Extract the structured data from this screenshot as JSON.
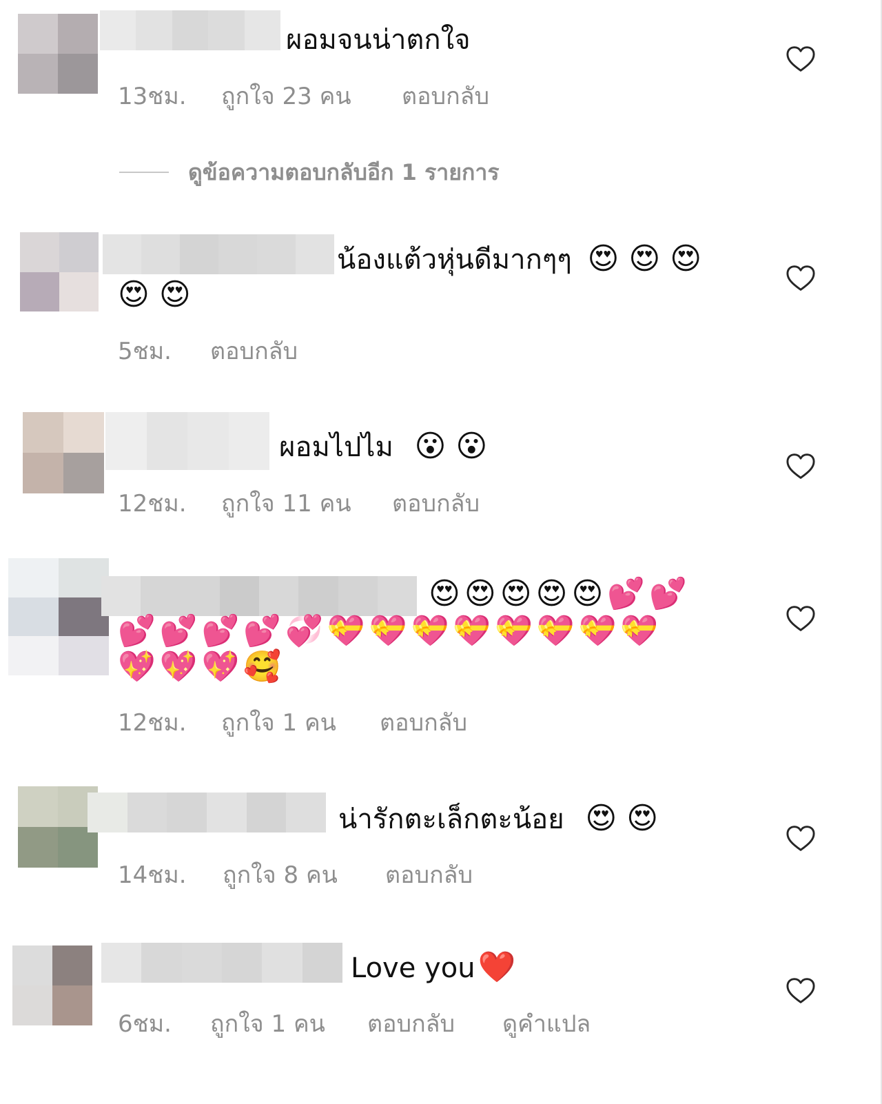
{
  "comments": [
    {
      "text": "ผอมจนน่าตกใจ",
      "emoji_line1": "",
      "emoji_line2": "",
      "time": "13ชม.",
      "likes": "ถูกใจ 23 คน",
      "reply": "ตอบกลับ",
      "translate": ""
    },
    {
      "text": "น้องแต้วหุ่นดีมากๆๆ",
      "emoji_line1": "😍 😍 😍",
      "emoji_line2": "😍 😍",
      "time": "5ชม.",
      "likes": "",
      "reply": "ตอบกลับ",
      "translate": ""
    },
    {
      "text": "ผอมไปไม",
      "emoji_line1": "😮 😮",
      "emoji_line2": "",
      "time": "12ชม.",
      "likes": "ถูกใจ 11 คน",
      "reply": "ตอบกลับ",
      "translate": ""
    },
    {
      "text": "",
      "emoji_line1": "😍😍😍😍😍💕💕",
      "emoji_line2": "💕💕💕💕💞💝💝💝💝💝💝💝💝",
      "emoji_line3": "💖💖💖🥰",
      "time": "12ชม.",
      "likes": "ถูกใจ 1 คน",
      "reply": "ตอบกลับ",
      "translate": ""
    },
    {
      "text": "น่ารักตะเล็กตะน้อย",
      "emoji_line1": "😍 😍",
      "emoji_line2": "",
      "time": "14ชม.",
      "likes": "ถูกใจ 8 คน",
      "reply": "ตอบกลับ",
      "translate": ""
    },
    {
      "text": "Love you",
      "emoji_line1": "❤️",
      "emoji_line2": "",
      "time": "6ชม.",
      "likes": "ถูกใจ 1 คน",
      "reply": "ตอบกลับ",
      "translate": "ดูคำแปล"
    }
  ],
  "view_replies": "ดูข้อความตอบกลับอีก 1 รายการ",
  "icons": {
    "like": "heart-outline-icon"
  },
  "colors": {
    "meta_gray": "#8e8e8e",
    "text": "#111111",
    "divider": "#c7c7c7"
  }
}
